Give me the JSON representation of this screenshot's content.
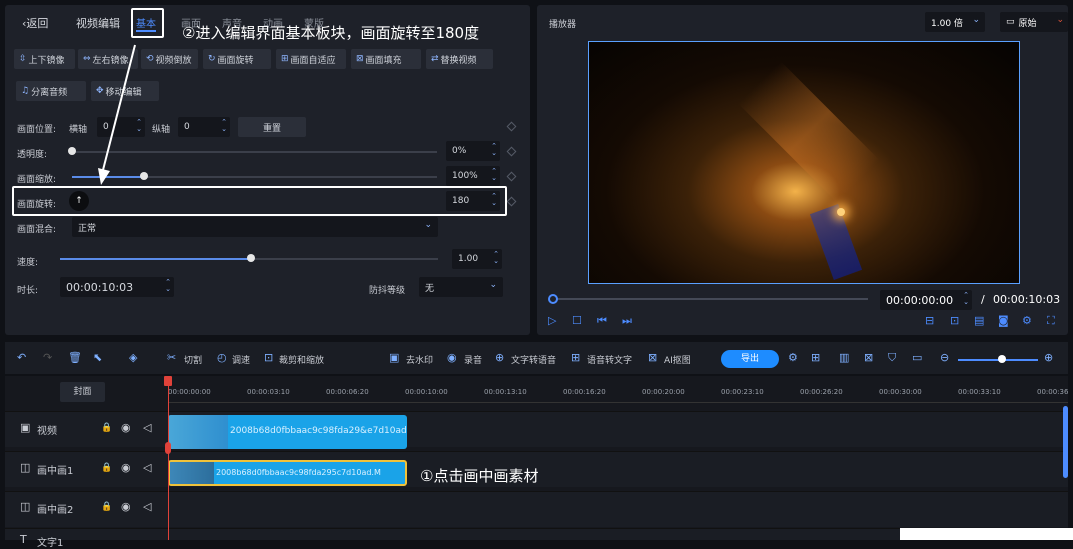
{
  "nav": {
    "back": "返回",
    "video_edit": "视频编辑",
    "basic": "基本",
    "tab3": "画面",
    "tab4": "声音",
    "tab5": "动画",
    "tab6": "蒙版"
  },
  "annotation": {
    "step2": "②进入编辑界面基本板块，画面旋转至180度",
    "step1": "①点击画中画素材"
  },
  "tools": [
    "上下镜像",
    "左右镜像",
    "视频倒放",
    "画面旋转",
    "画面自适应",
    "画面填充",
    "替换视频",
    "分离音频",
    "移动编辑"
  ],
  "props": {
    "position_label": "画面位置:",
    "h_axis": "横轴",
    "h_val": "0",
    "v_axis": "纵轴",
    "v_val": "0",
    "reset": "重置",
    "opacity_label": "透明度:",
    "opacity_val": "0%",
    "scale_label": "画面缩放:",
    "scale_val": "100%",
    "rotate_label": "画面旋转:",
    "rotate_val": "180",
    "blend_label": "画面混合:",
    "blend_val": "正常",
    "speed_label": "速度:",
    "speed_val": "1.00",
    "duration_label": "时长:",
    "duration_val": "00:00:10:03",
    "shake_label": "防抖等级",
    "shake_val": "无",
    "opacity": 0.0,
    "scale": 0.17,
    "speed": 0.5
  },
  "player": {
    "title": "播放器",
    "speed": "1.00 倍",
    "ratio": "原始",
    "current": "00:00:00:00",
    "sep": "/",
    "total": "00:00:10:03"
  },
  "toolbar": {
    "cut": "切割",
    "tone": "调速",
    "crop": "裁剪和缩放",
    "watermark": "去水印",
    "record": "录音",
    "tts": "文字转语音",
    "stt": "语音转文字",
    "ai": "AI抠图",
    "export": "导出"
  },
  "timeline": {
    "cover": "封面",
    "ticks": [
      "00:00:00:00",
      "00:00:03:10",
      "00:00:06:20",
      "00:00:10:00",
      "00:00:13:10",
      "00:00:16:20",
      "00:00:20:00",
      "00:00:23:10",
      "00:00:26:20",
      "00:00:30:00",
      "00:00:33:10",
      "00:00:36"
    ],
    "tracks": [
      {
        "name": "视频"
      },
      {
        "name": "画中画1"
      },
      {
        "name": "画中画2"
      },
      {
        "name": "文字1"
      }
    ],
    "clip_video": "2008b68d0fbbaac9c98fda29&e7d10ad",
    "clip_pip": "2008b68d0fbbaac9c98fda295c7d10ad.M"
  },
  "colors": {
    "accent": "#4d8cff",
    "export": "#1e8cff",
    "clip": "#1aa3e8"
  }
}
